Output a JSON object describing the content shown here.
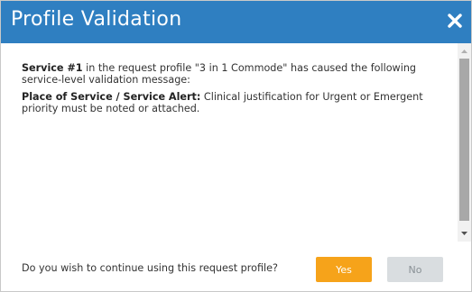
{
  "dialog": {
    "title": "Profile Validation",
    "close_icon": "close-x-icon",
    "message": {
      "service_label": "Service #1",
      "service_text": " in the request profile \"3 in 1 Commode\" has caused the following service-level validation message:",
      "alert_label": "Place of Service / Service Alert:",
      "alert_text": " Clinical justification for Urgent or Emergent priority must be noted or attached."
    },
    "question": "Do you wish to continue using this request profile?",
    "yes_label": "Yes",
    "no_label": "No"
  },
  "colors": {
    "titlebar": "#2f7fc1",
    "yes_button": "#f6a31a",
    "no_button": "#d9dde0"
  }
}
